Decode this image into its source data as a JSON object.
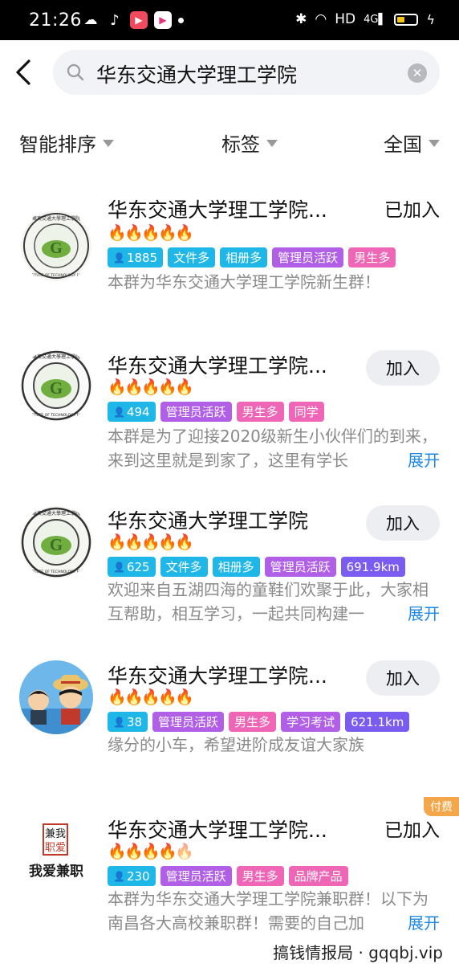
{
  "status_bar": {
    "time": "21:26",
    "network": "HD",
    "signal": "4G",
    "icons": [
      "wechat-icon",
      "tiktok-icon",
      "red-app-icon",
      "video-app-icon",
      "dot-icon",
      "bluetooth-icon",
      "wifi-icon",
      "battery-icon"
    ]
  },
  "search": {
    "query": "华东交通大学理工学院"
  },
  "filters": {
    "sort": "智能排序",
    "tag": "标签",
    "region": "全国"
  },
  "fire_icon": "🔥",
  "results": [
    {
      "title": "华东交通大学理工学院...",
      "fires": 5,
      "tags": [
        "1885",
        "文件多",
        "相册多",
        "管理员活跃",
        "男生多"
      ],
      "desc": "本群为华东交通大学理工学院新生群！",
      "action": "已加入",
      "has_expand": false
    },
    {
      "title": "华东交通大学理工学院...",
      "fires": 5,
      "tags": [
        "494",
        "管理员活跃",
        "男生多",
        "同学"
      ],
      "desc": "本群是为了迎接2020级新生小伙伴们的到来，来到这里就是到家了，这里有学长",
      "action": "加入",
      "has_expand": true
    },
    {
      "title": "华东交通大学理工学院",
      "fires": 5,
      "tags": [
        "625",
        "文件多",
        "相册多",
        "管理员活跃",
        "691.9km"
      ],
      "desc": "欢迎来自五湖四海的童鞋们欢聚于此，大家相互帮助，相互学习，一起共同构建一",
      "action": "加入",
      "has_expand": true
    },
    {
      "title": "华东交通大学理工学院...",
      "fires": 5,
      "tags": [
        "38",
        "管理员活跃",
        "男生多",
        "学习考试",
        "621.1km"
      ],
      "desc": "缘分的小车，希望进阶成友谊大家族",
      "action": "加入",
      "has_expand": false
    },
    {
      "title": "华东交通大学理工学院...",
      "fires": 5,
      "tags": [
        "230",
        "管理员活跃",
        "男生多",
        "品牌产品"
      ],
      "desc": "本群为华东交通大学理工学院兼职群！以下为南昌各大高校兼职群！需要的自己加",
      "action": "已加入",
      "has_expand": true,
      "badge": "付费"
    }
  ],
  "expand_label": "展开",
  "avatar_texts": {
    "seal_ring": "INSTITUTE OF TECHNOLOGY ECJTU",
    "seal_top": "華東交通大學理工學院",
    "job_logo_box_top": "兼我",
    "job_logo_box_bottom": "职爱",
    "job_logo_text": "我爱兼职"
  },
  "watermark": "搞钱情报局 · gqqbj.vip",
  "colors": {
    "tag_cyan": "#1fb6e8",
    "tag_purple": "#b05fe6",
    "tag_pink": "#f066b7",
    "tag_violet": "#7a5cf0",
    "link_blue": "#1e88e5",
    "paid_orange": "#f4a64a"
  }
}
